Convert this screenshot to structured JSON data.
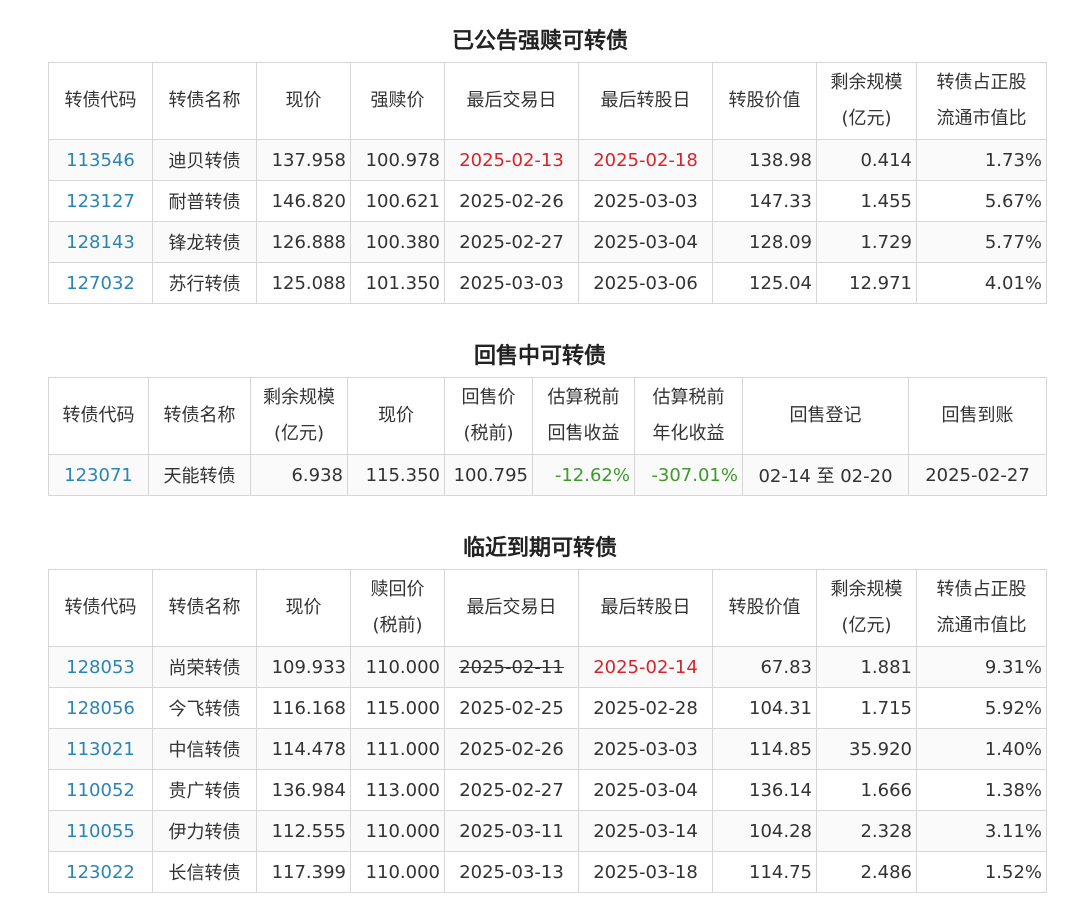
{
  "colors": {
    "code": "#2a84b5",
    "red": "#d8232a",
    "green": "#3d9a2a",
    "border": "#d6d6d6"
  },
  "redemption": {
    "title": "已公告强赎可转债",
    "headers": [
      "转债代码",
      "转债名称",
      "现价",
      "强赎价",
      "最后交易日",
      "最后转股日",
      "转股价值",
      "剩余规模|(亿元)",
      "转债占正股|流通市值比"
    ],
    "rows": [
      [
        "113546",
        "迪贝转债",
        "137.958",
        "100.978",
        "2025-02-13",
        "2025-02-18",
        "138.98",
        "0.414",
        "1.73%"
      ],
      [
        "123127",
        "耐普转债",
        "146.820",
        "100.621",
        "2025-02-26",
        "2025-03-03",
        "147.33",
        "1.455",
        "5.67%"
      ],
      [
        "128143",
        "锋龙转债",
        "126.888",
        "100.380",
        "2025-02-27",
        "2025-03-04",
        "128.09",
        "1.729",
        "5.77%"
      ],
      [
        "127032",
        "苏行转债",
        "125.088",
        "101.350",
        "2025-03-03",
        "2025-03-06",
        "125.04",
        "12.971",
        "4.01%"
      ]
    ]
  },
  "putback": {
    "title": "回售中可转债",
    "headers": [
      "转债代码",
      "转债名称",
      "剩余规模|(亿元)",
      "现价",
      "回售价|(税前)",
      "估算税前|回售收益",
      "估算税前|年化收益",
      "回售登记",
      "回售到账"
    ],
    "rows": [
      [
        "123071",
        "天能转债",
        "6.938",
        "115.350",
        "100.795",
        "-12.62%",
        "-307.01%",
        "02-14 至 02-20",
        "2025-02-27"
      ]
    ]
  },
  "maturity": {
    "title": "临近到期可转债",
    "headers": [
      "转债代码",
      "转债名称",
      "现价",
      "赎回价|(税前)",
      "最后交易日",
      "最后转股日",
      "转股价值",
      "剩余规模|(亿元)",
      "转债占正股|流通市值比"
    ],
    "rows": [
      [
        "128053",
        "尚荣转债",
        "109.933",
        "110.000",
        "2025-02-11",
        "2025-02-14",
        "67.83",
        "1.881",
        "9.31%"
      ],
      [
        "128056",
        "今飞转债",
        "116.168",
        "115.000",
        "2025-02-25",
        "2025-02-28",
        "104.31",
        "1.715",
        "5.92%"
      ],
      [
        "113021",
        "中信转债",
        "114.478",
        "111.000",
        "2025-02-26",
        "2025-03-03",
        "114.85",
        "35.920",
        "1.40%"
      ],
      [
        "110052",
        "贵广转债",
        "136.984",
        "113.000",
        "2025-02-27",
        "2025-03-04",
        "136.14",
        "1.666",
        "1.38%"
      ],
      [
        "110055",
        "伊力转债",
        "112.555",
        "110.000",
        "2025-03-11",
        "2025-03-14",
        "104.28",
        "2.328",
        "3.11%"
      ],
      [
        "123022",
        "长信转债",
        "117.399",
        "110.000",
        "2025-03-13",
        "2025-03-18",
        "114.75",
        "2.486",
        "1.52%"
      ]
    ]
  }
}
